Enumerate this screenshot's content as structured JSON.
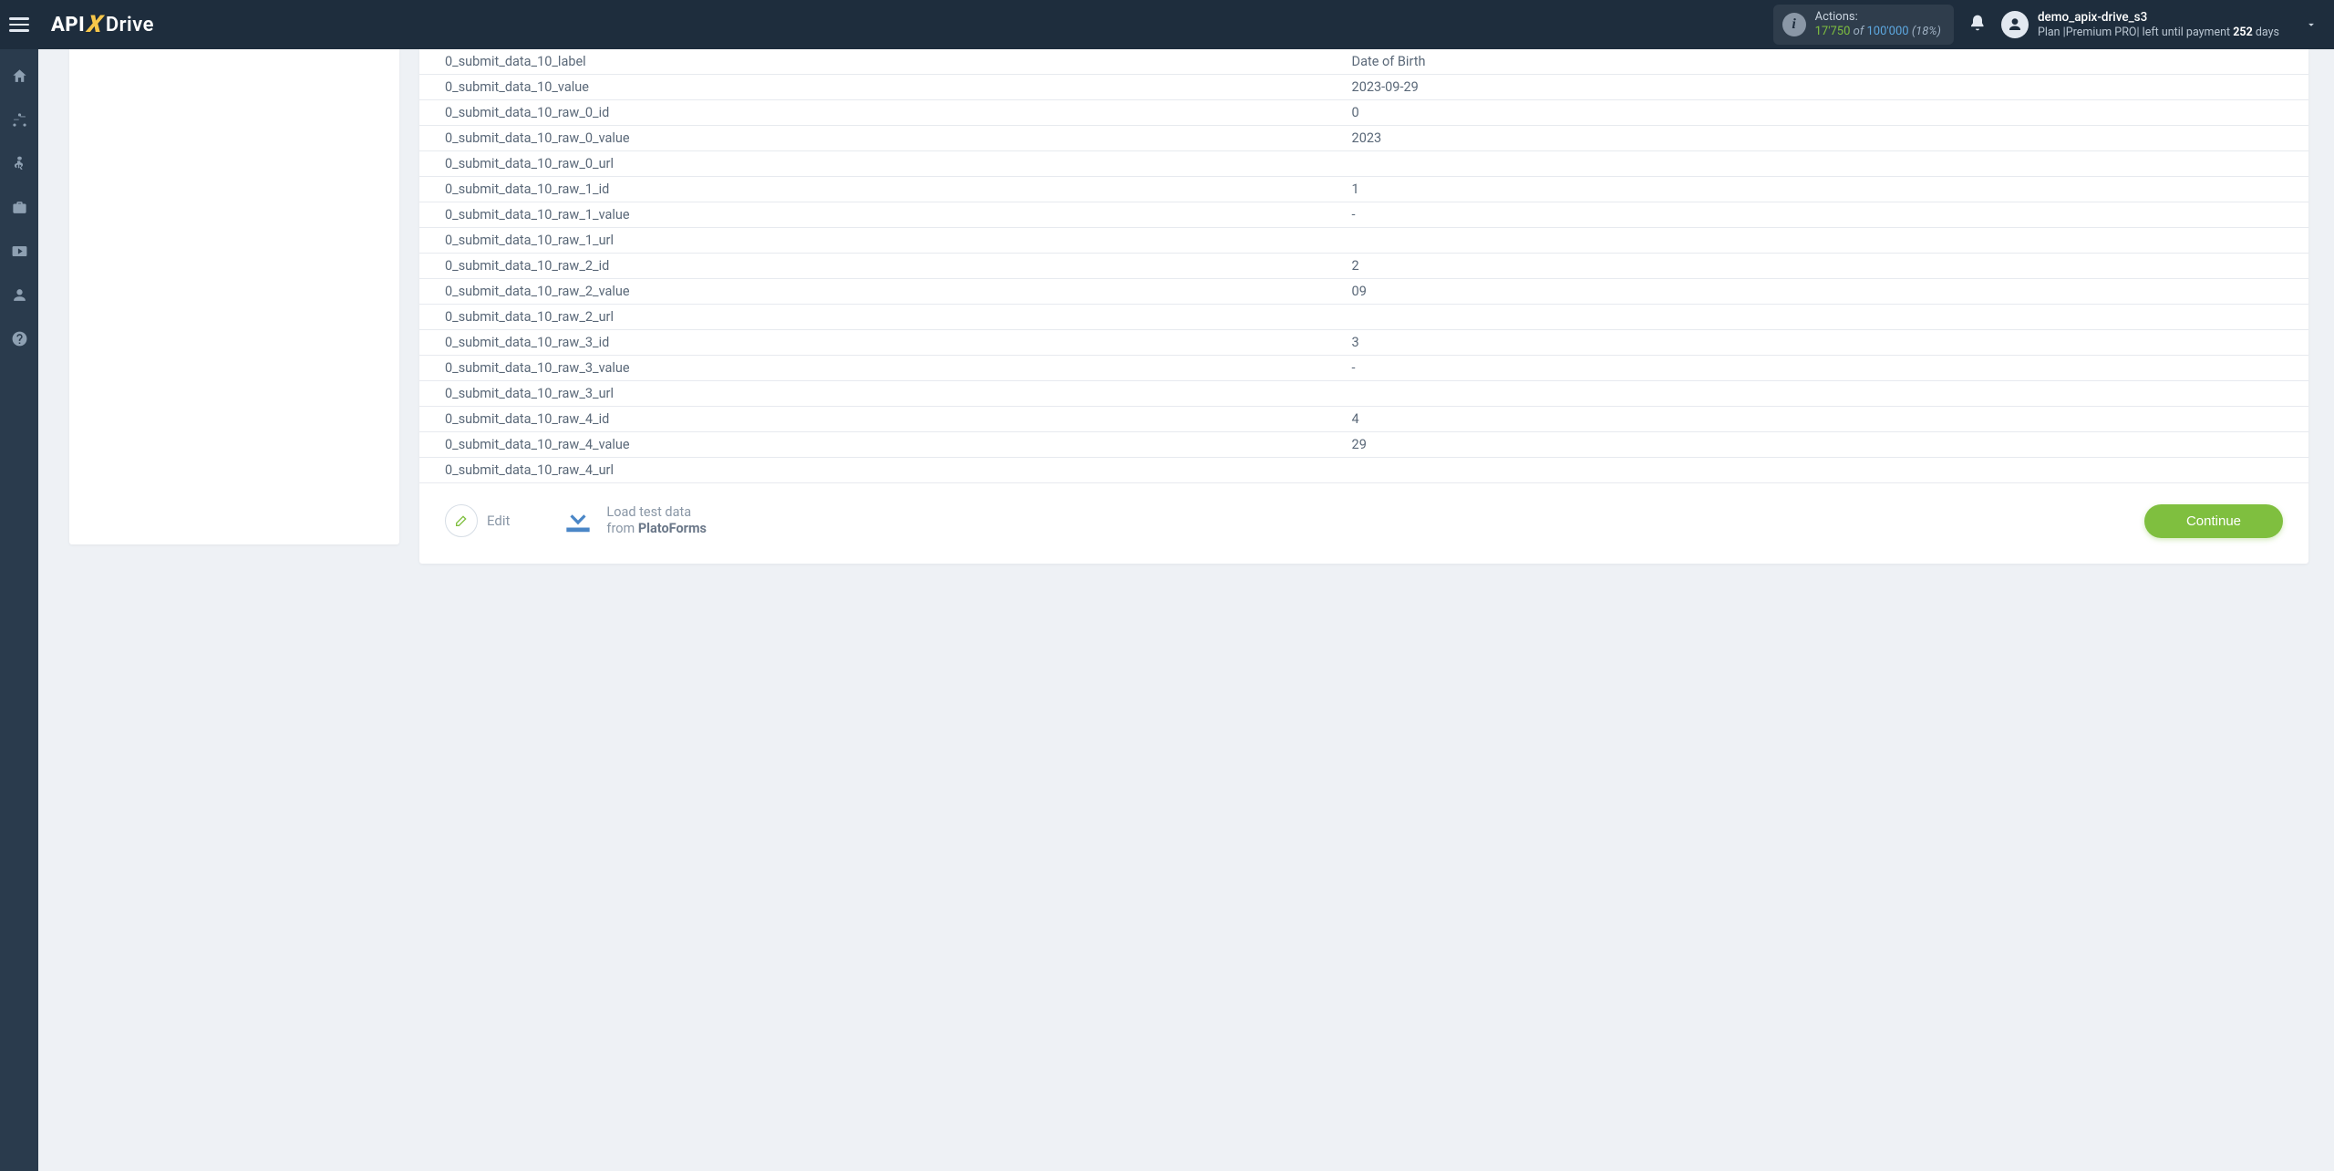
{
  "header": {
    "logo": {
      "part1": "API",
      "part2": "X",
      "part3": "Drive"
    },
    "actions": {
      "label": "Actions:",
      "used": "17'750",
      "of": "of",
      "total": "100'000",
      "pct": "(18%)"
    },
    "user": {
      "name": "demo_apix-drive_s3",
      "plan_prefix": "Plan |",
      "plan_name": "Premium PRO",
      "plan_mid": "| left until payment ",
      "days_num": "252",
      "days_suffix": " days"
    }
  },
  "rows": [
    {
      "k": "0_submit_data_10_label",
      "v": "Date of Birth"
    },
    {
      "k": "0_submit_data_10_value",
      "v": "2023-09-29"
    },
    {
      "k": "0_submit_data_10_raw_0_id",
      "v": "0"
    },
    {
      "k": "0_submit_data_10_raw_0_value",
      "v": "2023"
    },
    {
      "k": "0_submit_data_10_raw_0_url",
      "v": ""
    },
    {
      "k": "0_submit_data_10_raw_1_id",
      "v": "1"
    },
    {
      "k": "0_submit_data_10_raw_1_value",
      "v": "-"
    },
    {
      "k": "0_submit_data_10_raw_1_url",
      "v": ""
    },
    {
      "k": "0_submit_data_10_raw_2_id",
      "v": "2"
    },
    {
      "k": "0_submit_data_10_raw_2_value",
      "v": "09"
    },
    {
      "k": "0_submit_data_10_raw_2_url",
      "v": ""
    },
    {
      "k": "0_submit_data_10_raw_3_id",
      "v": "3"
    },
    {
      "k": "0_submit_data_10_raw_3_value",
      "v": "-"
    },
    {
      "k": "0_submit_data_10_raw_3_url",
      "v": ""
    },
    {
      "k": "0_submit_data_10_raw_4_id",
      "v": "4"
    },
    {
      "k": "0_submit_data_10_raw_4_value",
      "v": "29"
    },
    {
      "k": "0_submit_data_10_raw_4_url",
      "v": ""
    }
  ],
  "footer": {
    "edit": "Edit",
    "load_line1": "Load test data",
    "load_from": "from ",
    "load_source": "PlatoForms",
    "continue": "Continue"
  }
}
